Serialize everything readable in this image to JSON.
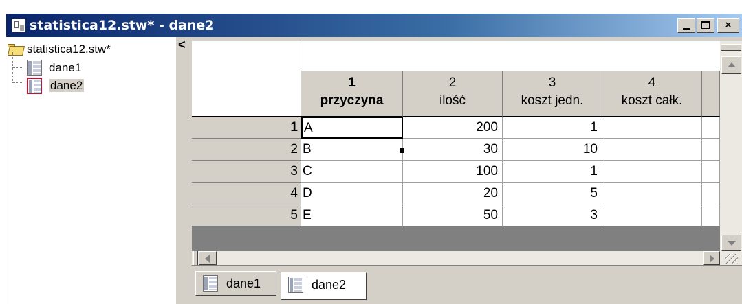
{
  "window": {
    "title": "statistica12.stw* - dane2",
    "buttons": {
      "minimize": "_",
      "maximize": "□",
      "close": "×"
    }
  },
  "tree": {
    "root": {
      "label": "statistica12.stw*",
      "icon": "folder-open-icon"
    },
    "items": [
      {
        "label": "dane1",
        "icon": "spreadsheet-icon",
        "selected": false
      },
      {
        "label": "dane2",
        "icon": "spreadsheet-icon",
        "selected": true
      }
    ],
    "collapse_glyph": "<"
  },
  "sheet": {
    "columns": [
      {
        "number": "1",
        "name": "przyczyna",
        "bold": true
      },
      {
        "number": "2",
        "name": "ilość",
        "bold": false
      },
      {
        "number": "3",
        "name": "koszt jedn.",
        "bold": false
      },
      {
        "number": "4",
        "name": "koszt całk.",
        "bold": false
      }
    ],
    "rows": [
      {
        "label": "1",
        "cells": [
          "A",
          "200",
          "1",
          ""
        ]
      },
      {
        "label": "2",
        "cells": [
          "B",
          "30",
          "10",
          ""
        ]
      },
      {
        "label": "3",
        "cells": [
          "C",
          "100",
          "1",
          ""
        ]
      },
      {
        "label": "4",
        "cells": [
          "D",
          "20",
          "5",
          ""
        ]
      },
      {
        "label": "5",
        "cells": [
          "E",
          "50",
          "3",
          ""
        ]
      }
    ],
    "active_cell": {
      "row": 1,
      "column": 1
    }
  },
  "tabs": [
    {
      "label": "dane1",
      "active": false
    },
    {
      "label": "dane2",
      "active": true
    }
  ],
  "colors": {
    "title_start": "#0a246a",
    "title_end": "#a6caf0",
    "face": "#d4d0c8",
    "selection_border": "#c8102e"
  }
}
